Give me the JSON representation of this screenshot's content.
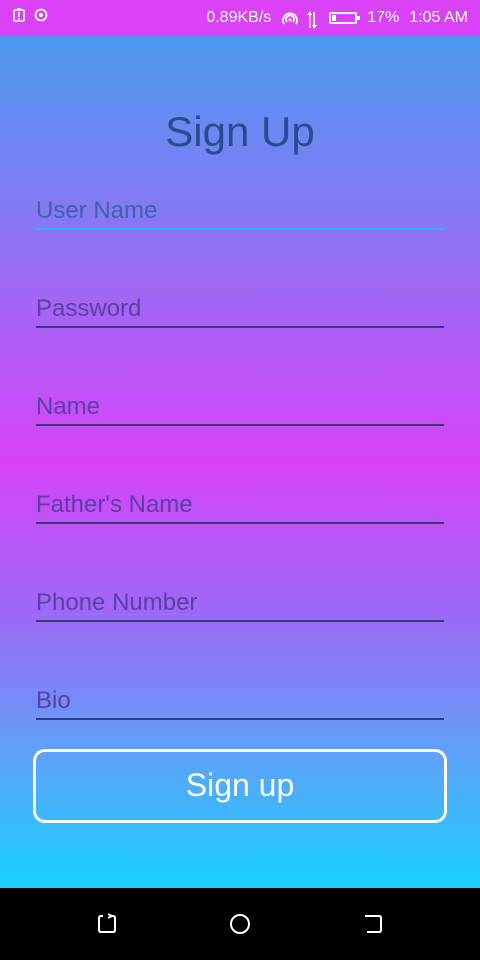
{
  "status_bar": {
    "left_icons": [
      "battery-alert-icon",
      "target-icon"
    ],
    "net_speed": "0.89KB/s",
    "right_icons": [
      "hotspot-icon",
      "data-transfer-icon",
      "battery-icon"
    ],
    "battery_percent": "17%",
    "battery_level": 0.17,
    "time": "1:05 AM"
  },
  "form": {
    "title": "Sign Up",
    "fields": [
      {
        "placeholder": "User Name",
        "value": ""
      },
      {
        "placeholder": "Password",
        "value": ""
      },
      {
        "placeholder": "Name",
        "value": ""
      },
      {
        "placeholder": "Father's Name",
        "value": ""
      },
      {
        "placeholder": "Phone Number",
        "value": ""
      },
      {
        "placeholder": "Bio",
        "value": ""
      }
    ],
    "submit_label": "Sign up"
  },
  "nav_bar": {
    "buttons": [
      "recent-apps-icon",
      "home-icon",
      "back-icon"
    ]
  },
  "colors": {
    "status_bar": "#d942f5",
    "title": "#2a4b8d",
    "active_underline": "#20b7f2",
    "button_border": "#ffffff"
  }
}
